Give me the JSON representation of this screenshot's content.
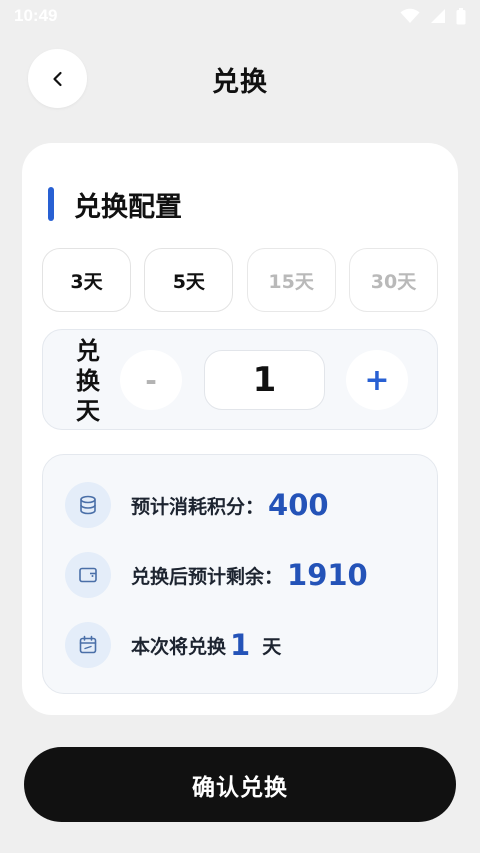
{
  "status_bar": {
    "time": "10:49"
  },
  "header": {
    "title": "兑换",
    "back_icon": "chevron-left-icon"
  },
  "config": {
    "section_title": "兑换配置",
    "accent_color": "#2860d3",
    "day_options": [
      {
        "label": "3天",
        "enabled": true
      },
      {
        "label": "5天",
        "enabled": true
      },
      {
        "label": "15天",
        "enabled": false
      },
      {
        "label": "30天",
        "enabled": false
      }
    ],
    "stepper": {
      "label_chars": [
        "兑",
        "换",
        "天"
      ],
      "minus_label": "-",
      "value": "1",
      "plus_label": "+"
    }
  },
  "summary": {
    "rows": [
      {
        "icon": "database-coins-icon",
        "label": "预计消耗积分：",
        "value": "400",
        "unit": ""
      },
      {
        "icon": "wallet-icon",
        "label": "兑换后预计剩余：",
        "value": "1910",
        "unit": ""
      },
      {
        "icon": "calendar-icon",
        "label": "本次将兑换",
        "value": "1",
        "unit": "天"
      }
    ],
    "value_color": "#2453b8"
  },
  "confirm_button": {
    "label": "确认兑换"
  }
}
